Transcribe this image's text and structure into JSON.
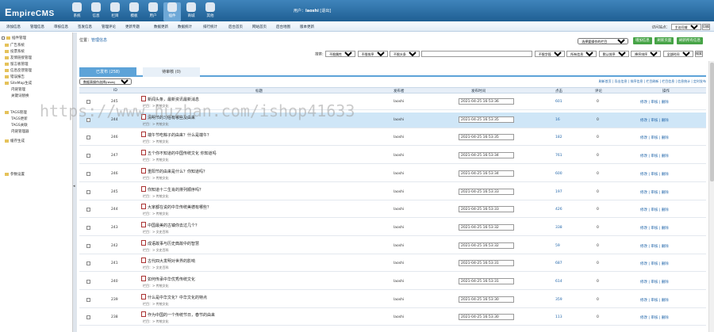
{
  "app": {
    "logo": "EmpireCMS",
    "logo_first": "E",
    "logo_rest": "mpireCMS"
  },
  "nav": [
    {
      "label": "系统",
      "icon": "system-icon"
    },
    {
      "label": "信息",
      "icon": "info-icon"
    },
    {
      "label": "栏目",
      "icon": "column-icon"
    },
    {
      "label": "模板",
      "icon": "template-icon"
    },
    {
      "label": "用户",
      "icon": "user-icon"
    },
    {
      "label": "插件",
      "icon": "plugin-icon",
      "active": true
    },
    {
      "label": "商城",
      "icon": "shop-icon"
    },
    {
      "label": "其他",
      "icon": "other-icon"
    }
  ],
  "user": {
    "prefix": "用户：",
    "name": "laoshi",
    "logout": "[退出]"
  },
  "menu": [
    "添加信息",
    "管理信息",
    "审核信息",
    "签发信息",
    "管理评论",
    "更新专题",
    "数据更新",
    "数据统计",
    "排行统计",
    "后台首页",
    "网站首页",
    "后台地图",
    "版本更新"
  ],
  "site_ctrl": {
    "label": "访问站点：",
    "select": "主访问域",
    "go": "切换"
  },
  "sidebar": {
    "root": "插件管理",
    "items": [
      "广告系统",
      "投票系统",
      "友情链接管理",
      "留言板管理",
      "信息反馈管理",
      "错误报告",
      "SiteMap生成",
      "内链管理",
      "关键词替换",
      "TAGS管理",
      "TAGS更新",
      "TAGS关联",
      "内链管理器",
      "缓存生成",
      "参数设置"
    ]
  },
  "breadcrumb": {
    "prefix": "位置：",
    "link": "管理信息"
  },
  "top_actions": {
    "select": "选择要操作的栏目",
    "buttons": [
      "增加信息",
      "刷新页面",
      "刷新所有信息"
    ]
  },
  "search": {
    "selects": [
      "不限属性",
      "不限排序",
      "不限头条",
      "不限字段",
      "所有信息",
      "默认排序",
      "降序排序",
      "全部时间"
    ],
    "button": "搜索"
  },
  "tabs": [
    {
      "label": "已发布 (258)",
      "active": true
    },
    {
      "label": "待审核 (0)",
      "active": false
    }
  ],
  "tool": {
    "select": "数据表操作选择(news)",
    "links": "刷新首页 | 导出信息 | 排序信息 | 栏目刷新 | 栏目信息 | 信息统计 | 定时发布"
  },
  "columns": {
    "id": "ID",
    "title": "标题",
    "publisher": "发布者",
    "time": "发布时间",
    "hits": "点击",
    "comments": "评论",
    "ops": "操作"
  },
  "rows": [
    {
      "id": "245",
      "title": "新闻头条，最新资讯最新消息",
      "cat": "栏目：> 传统文化",
      "time": "2021-04-25 16:53:36",
      "hits": "601",
      "cmt": "0",
      "sel": false
    },
    {
      "id": "244",
      "title": "清明节的习俗有哪些及由来",
      "cat": "栏目：> 传统文化",
      "time": "2021-04-25 16:53:35",
      "hits": "16",
      "cmt": "0",
      "sel": true
    },
    {
      "id": "246",
      "title": "端午节吃粽子的由来？什么是端午？",
      "cat": "栏目：> 传统文化",
      "time": "2021-04-25 16:53:35",
      "hits": "182",
      "cmt": "0",
      "sel": false
    },
    {
      "id": "247",
      "title": "五个你不知道的中国传统文化 你知道吗",
      "cat": "栏目：> 传统文化",
      "time": "2021-04-25 16:53:34",
      "hits": "761",
      "cmt": "0",
      "sel": false
    },
    {
      "id": "246",
      "title": "重阳节的由来是什么？你知道吗？",
      "cat": "栏目：> 传统文化",
      "time": "2021-04-25 16:53:34",
      "hits": "600",
      "cmt": "0",
      "sel": false
    },
    {
      "id": "245",
      "title": "你知道十二生肖的排列顺序吗？",
      "cat": "栏目：> 传统文化",
      "time": "2021-04-25 16:53:33",
      "hits": "197",
      "cmt": "0",
      "sel": false
    },
    {
      "id": "244",
      "title": "大家都在说的中华传统美德有哪些？",
      "cat": "栏目：> 传统文化",
      "time": "2021-04-25 16:53:33",
      "hits": "426",
      "cmt": "0",
      "sel": false
    },
    {
      "id": "243",
      "title": "中国最美的古镇你去过几个？",
      "cat": "栏目：> 文史百科",
      "time": "2021-04-25 16:53:32",
      "hits": "338",
      "cmt": "0",
      "sel": false
    },
    {
      "id": "242",
      "title": "成语故事与历史典故中的智慧",
      "cat": "栏目：> 文史百科",
      "time": "2021-04-25 16:53:32",
      "hits": "59",
      "cmt": "0",
      "sel": false
    },
    {
      "id": "241",
      "title": "古代四大发明对世界的影响",
      "cat": "栏目：> 文史百科",
      "time": "2021-04-25 16:53:31",
      "hits": "687",
      "cmt": "0",
      "sel": false
    },
    {
      "id": "240",
      "title": "如何传承中华优秀传统文化",
      "cat": "栏目：> 传统文化",
      "time": "2021-04-25 16:53:31",
      "hits": "614",
      "cmt": "0",
      "sel": false
    },
    {
      "id": "239",
      "title": "什么是中华文化？中华文化的特点",
      "cat": "栏目：> 传统文化",
      "time": "2021-04-25 16:53:30",
      "hits": "359",
      "cmt": "0",
      "sel": false
    },
    {
      "id": "238",
      "title": "作为中国的一个传统节日，春节的由来",
      "cat": "栏目：> 传统文化",
      "time": "2021-04-25 16:53:30",
      "hits": "113",
      "cmt": "0",
      "sel": false
    }
  ],
  "ops": {
    "edit": "修改",
    "check": "审核",
    "delete": "删除"
  },
  "watermark": "https://www.huzhan.com/ishop41633"
}
